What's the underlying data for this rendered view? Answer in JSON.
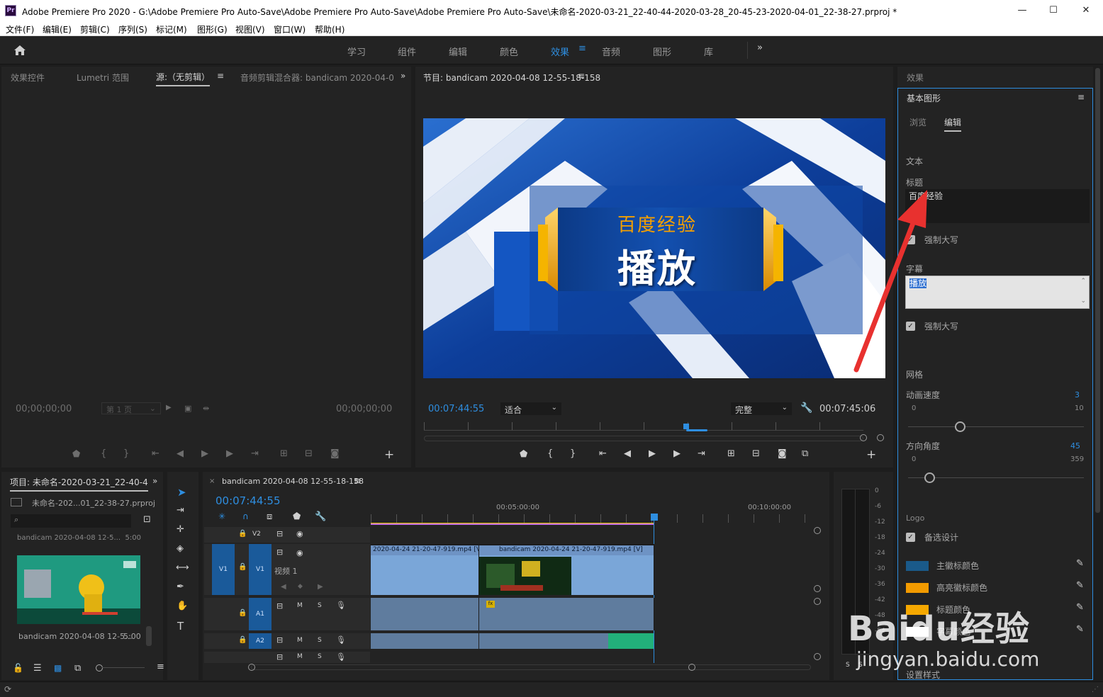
{
  "titlebar": {
    "title": "Adobe Premiere Pro 2020 - G:\\Adobe Premiere Pro Auto-Save\\Adobe Premiere Pro Auto-Save\\Adobe Premiere Pro Auto-Save\\未命名-2020-03-21_22-40-44-2020-03-28_20-45-23-2020-04-01_22-38-27.prproj *",
    "logo": "Pr"
  },
  "menu": [
    "文件(F)",
    "编辑(E)",
    "剪辑(C)",
    "序列(S)",
    "标记(M)",
    "图形(G)",
    "视图(V)",
    "窗口(W)",
    "帮助(H)"
  ],
  "workspaces": [
    "学习",
    "组件",
    "编辑",
    "颜色",
    "效果",
    "音频",
    "图形",
    "库"
  ],
  "workspace_active": "效果",
  "source_panel": {
    "tabs": [
      "效果控件",
      "Lumetri 范围",
      "源:（无剪辑）",
      "音频剪辑混合器: bandicam 2020-04-0"
    ],
    "timecode_left": "00;00;00;00",
    "page": "第 1 页",
    "timecode_right": "00;00;00;00"
  },
  "program_panel": {
    "tab": "节目: bandicam 2020-04-08 12-55-18-158",
    "preview_text_top": "百度经验",
    "preview_text_main": "播放",
    "timecode_current": "00:07:44:55",
    "fit": "适合",
    "quality": "完整",
    "timecode_duration": "00:07:45:06"
  },
  "project_panel": {
    "tab": "项目: 未命名-2020-03-21_22-40-4",
    "file": "未命名-202...01_22-38-27.prproj",
    "clip_label_top": "bandicam 2020-04-08 12-5...",
    "clip_duration_top": "5:00",
    "clip_label": "bandicam 2020-04-08 12-5...",
    "clip_duration": "5:00"
  },
  "timeline": {
    "tab": "bandicam 2020-04-08 12-55-18-158",
    "timecode": "00:07:44:55",
    "ruler": [
      "00:05:00:00",
      "00:10:00:00"
    ],
    "tracks": {
      "v2": "V2",
      "v1_src": "V1",
      "v1": "V1",
      "v1_name": "视频 1",
      "a1": "A1",
      "a2": "A2"
    },
    "clip1_title": "2020-04-24 21-20-47-919.mp4 [V]",
    "clip2_title": "bandicam 2020-04-24 21-20-47-919.mp4 [V]",
    "fx": "fx",
    "m": "M",
    "s": "S"
  },
  "audio_meter": {
    "scale": [
      "0",
      "-6",
      "-12",
      "-18",
      "-24",
      "-30",
      "-36",
      "-42",
      "-48",
      "-54"
    ],
    "solo": "S"
  },
  "effects_panel": {
    "header": "效果",
    "title": "基本图形",
    "tabs": [
      "浏览",
      "编辑"
    ],
    "tab_active": "编辑",
    "section_text": "文本",
    "label_title": "标题",
    "title_value": "百度经验",
    "force_caps_1": "强制大写",
    "label_subtitle": "字幕",
    "subtitle_value": "播放",
    "force_caps_2": "强制大写",
    "section_grid": "网格",
    "anim_speed_label": "动画速度",
    "anim_speed_value": "3",
    "anim_speed_min": "0",
    "anim_speed_max": "10",
    "anim_speed_fraction": 0.3,
    "direction_label": "方向角度",
    "direction_value": "45",
    "direction_min": "0",
    "direction_max": "359",
    "direction_fraction": 0.125,
    "section_logo": "Logo",
    "alt_design": "备选设计",
    "colors": [
      {
        "label": "主徽标颜色",
        "color": "#1a5a8a"
      },
      {
        "label": "高亮徽标颜色",
        "color": "#f39b00"
      },
      {
        "label": "标题颜色",
        "color": "#f5a800"
      },
      {
        "label": "字幕颜色",
        "color": "#ffffff"
      }
    ],
    "setting_style": "设置样式"
  },
  "watermark": {
    "brand": "Baidu经验",
    "url": "jingyan.baidu.com"
  },
  "colors": {
    "accent": "#2e8ee0",
    "arrow": "#e8312f",
    "timeline_blue": "#1a5a9a"
  }
}
